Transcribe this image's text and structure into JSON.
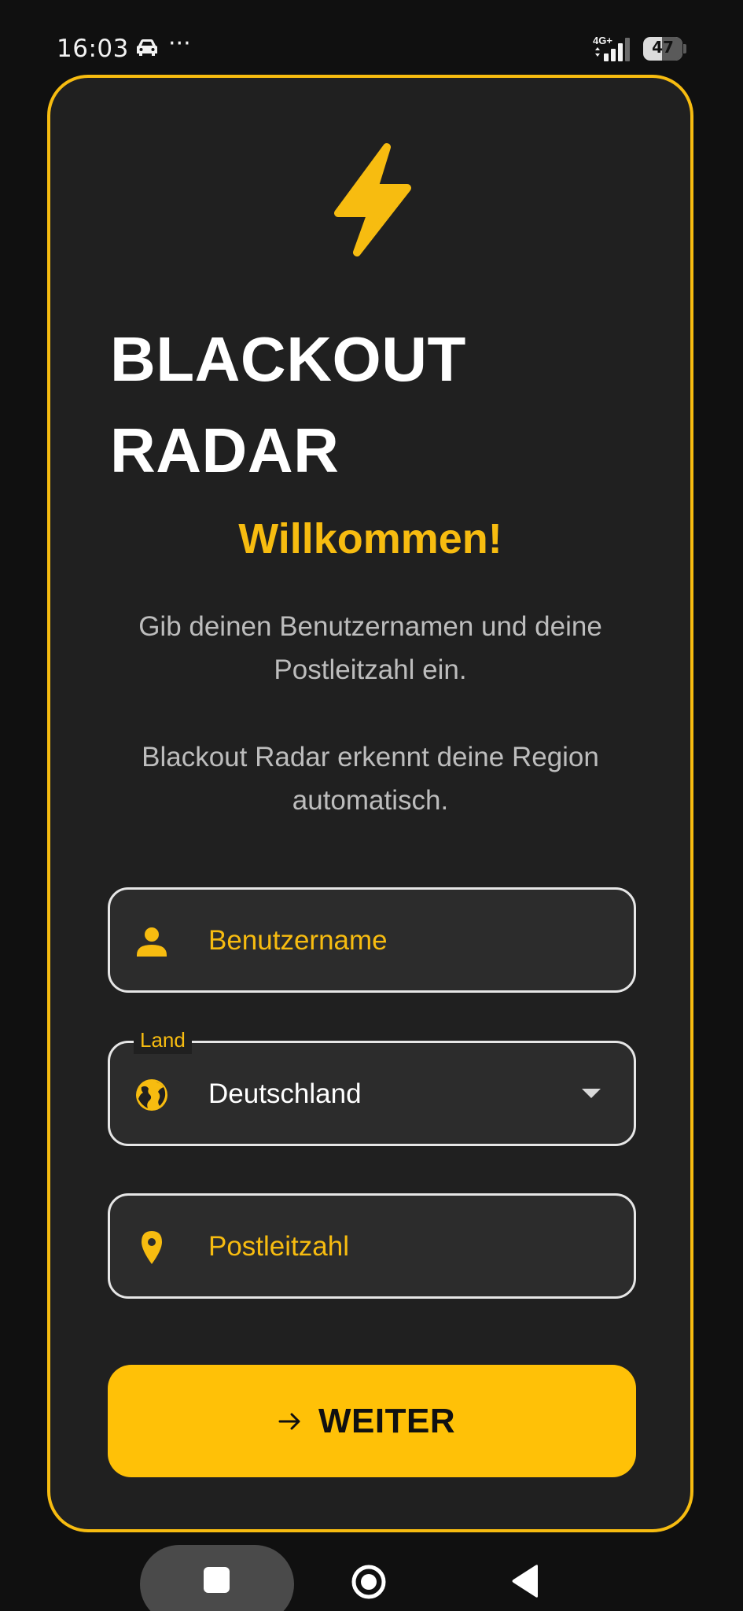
{
  "status_bar": {
    "time": "16:03",
    "more": "···",
    "network": "4G+",
    "battery_level": "47",
    "icons": [
      "car-icon",
      "signal-icon",
      "battery-icon"
    ]
  },
  "app": {
    "title": "BLACKOUT RADAR",
    "welcome": "Willkommen!",
    "description_1": "Gib deinen Benutzernamen und deine Postleitzahl ein.",
    "description_2": "Blackout Radar erkennt deine Region automatisch."
  },
  "form": {
    "username": {
      "placeholder": "Benutzername",
      "value": "",
      "icon": "person-icon"
    },
    "country": {
      "label": "Land",
      "selected": "Deutschland",
      "icon": "globe-icon"
    },
    "zip": {
      "placeholder": "Postleitzahl",
      "value": "",
      "icon": "location-pin-icon"
    },
    "continue_label": "WEITER"
  },
  "colors": {
    "accent": "#ffc107",
    "card_bg": "#202020",
    "page_bg": "#101010",
    "field_bg": "#2c2c2c"
  }
}
